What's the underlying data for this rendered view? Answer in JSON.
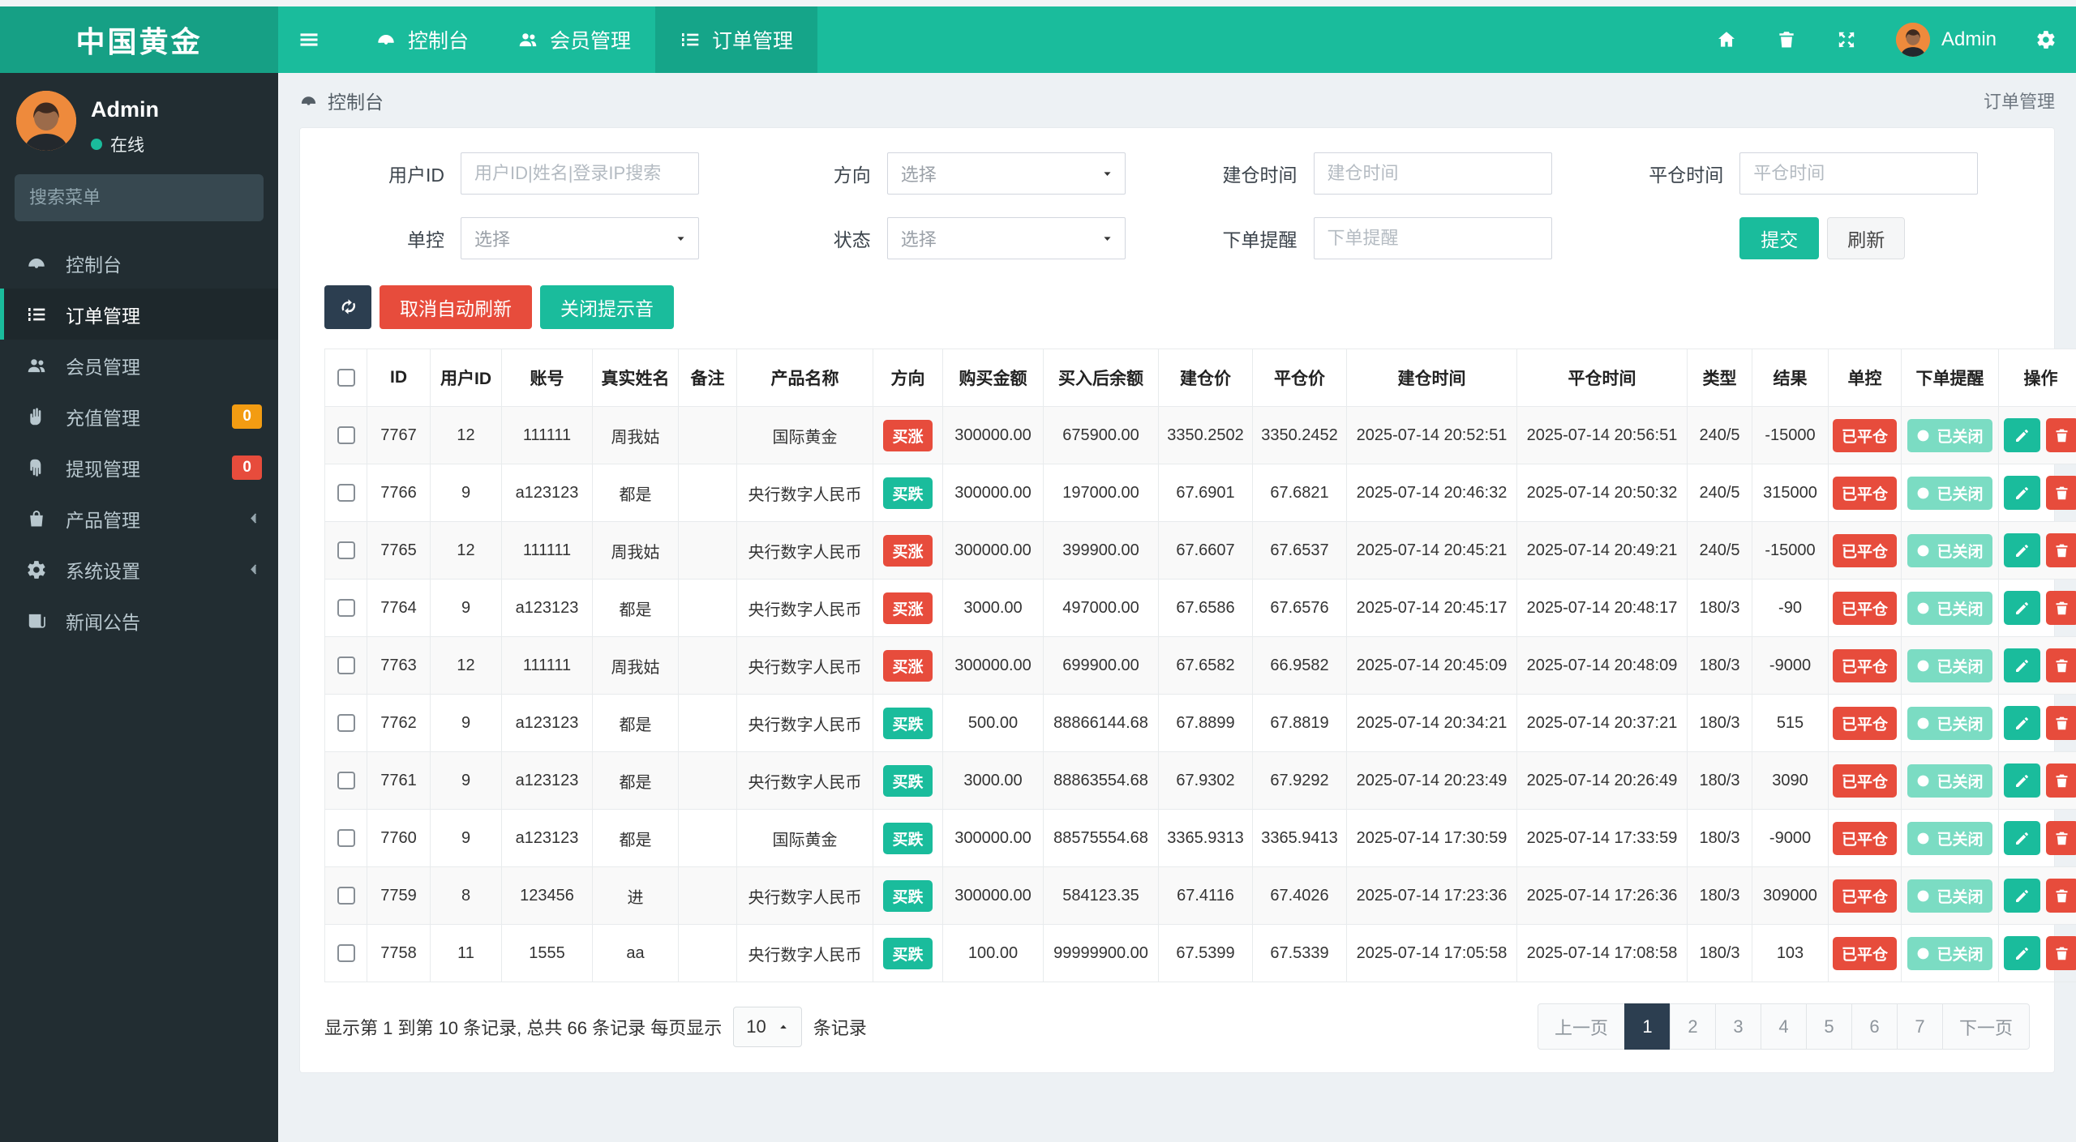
{
  "brand": {
    "title": "中国黄金"
  },
  "topnav": {
    "tabs": [
      {
        "name": "console",
        "label": "控制台",
        "icon": "gauge",
        "active": false
      },
      {
        "name": "members",
        "label": "会员管理",
        "icon": "users",
        "active": false
      },
      {
        "name": "orders",
        "label": "订单管理",
        "icon": "list",
        "active": true
      }
    ],
    "user_name": "Admin"
  },
  "sidebar": {
    "user": {
      "name": "Admin",
      "status": "在线"
    },
    "search_placeholder": "搜索菜单",
    "items": [
      {
        "name": "console",
        "label": "控制台",
        "icon": "gauge"
      },
      {
        "name": "orders",
        "label": "订单管理",
        "icon": "list",
        "active": true
      },
      {
        "name": "members",
        "label": "会员管理",
        "icon": "users"
      },
      {
        "name": "recharge",
        "label": "充值管理",
        "icon": "hand-up",
        "badge": "0",
        "badge_color": "#F39C12"
      },
      {
        "name": "withdraw",
        "label": "提现管理",
        "icon": "hand-down",
        "badge": "0",
        "badge_color": "#E74C3C"
      },
      {
        "name": "products",
        "label": "产品管理",
        "icon": "bag",
        "chevron": true
      },
      {
        "name": "settings",
        "label": "系统设置",
        "icon": "gear",
        "chevron": true
      },
      {
        "name": "news",
        "label": "新闻公告",
        "icon": "news"
      }
    ]
  },
  "breadcrumb": {
    "left": "控制台",
    "right": "订单管理"
  },
  "filters": {
    "fields": {
      "user_id": {
        "label": "用户ID",
        "placeholder": "用户ID|姓名|登录IP搜索"
      },
      "direction": {
        "label": "方向",
        "value": "选择"
      },
      "open_time": {
        "label": "建仓时间",
        "placeholder": "建仓时间"
      },
      "close_time": {
        "label": "平仓时间",
        "placeholder": "平仓时间"
      },
      "control": {
        "label": "单控",
        "value": "选择"
      },
      "status": {
        "label": "状态",
        "value": "选择"
      },
      "order_alert": {
        "label": "下单提醒",
        "placeholder": "下单提醒"
      }
    },
    "submit_label": "提交",
    "refresh_label": "刷新"
  },
  "toolbar": {
    "cancel_auto_refresh": "取消自动刷新",
    "mute_sound": "关闭提示音"
  },
  "colors": {
    "up": "#E74C3C",
    "down": "#1ABC9C",
    "closed_badge": "#7BDCC3",
    "control_badge": "#E74C3C"
  },
  "table": {
    "columns": [
      "ID",
      "用户ID",
      "账号",
      "真实姓名",
      "备注",
      "产品名称",
      "方向",
      "购买金额",
      "买入后余额",
      "建仓价",
      "平仓价",
      "建仓时间",
      "平仓时间",
      "类型",
      "结果",
      "单控",
      "下单提醒",
      "操作"
    ],
    "rows": [
      {
        "id": "7767",
        "user_id": "12",
        "account": "111111",
        "real_name": "周我姑",
        "note": "",
        "product": "国际黄金",
        "direction": {
          "label": "买涨",
          "kind": "up"
        },
        "amount": "300000.00",
        "balance_after": "675900.00",
        "open_price": "3350.2502",
        "close_price": "3350.2452",
        "open_time": "2025-07-14 20:52:51",
        "close_time": "2025-07-14 20:56:51",
        "type": "240/5",
        "result": "-15000",
        "control": "已平仓",
        "notify": "已关闭"
      },
      {
        "id": "7766",
        "user_id": "9",
        "account": "a123123",
        "real_name": "都是",
        "note": "",
        "product": "央行数字人民币",
        "direction": {
          "label": "买跌",
          "kind": "down"
        },
        "amount": "300000.00",
        "balance_after": "197000.00",
        "open_price": "67.6901",
        "close_price": "67.6821",
        "open_time": "2025-07-14 20:46:32",
        "close_time": "2025-07-14 20:50:32",
        "type": "240/5",
        "result": "315000",
        "control": "已平仓",
        "notify": "已关闭"
      },
      {
        "id": "7765",
        "user_id": "12",
        "account": "111111",
        "real_name": "周我姑",
        "note": "",
        "product": "央行数字人民币",
        "direction": {
          "label": "买涨",
          "kind": "up"
        },
        "amount": "300000.00",
        "balance_after": "399900.00",
        "open_price": "67.6607",
        "close_price": "67.6537",
        "open_time": "2025-07-14 20:45:21",
        "close_time": "2025-07-14 20:49:21",
        "type": "240/5",
        "result": "-15000",
        "control": "已平仓",
        "notify": "已关闭"
      },
      {
        "id": "7764",
        "user_id": "9",
        "account": "a123123",
        "real_name": "都是",
        "note": "",
        "product": "央行数字人民币",
        "direction": {
          "label": "买涨",
          "kind": "up"
        },
        "amount": "3000.00",
        "balance_after": "497000.00",
        "open_price": "67.6586",
        "close_price": "67.6576",
        "open_time": "2025-07-14 20:45:17",
        "close_time": "2025-07-14 20:48:17",
        "type": "180/3",
        "result": "-90",
        "control": "已平仓",
        "notify": "已关闭"
      },
      {
        "id": "7763",
        "user_id": "12",
        "account": "111111",
        "real_name": "周我姑",
        "note": "",
        "product": "央行数字人民币",
        "direction": {
          "label": "买涨",
          "kind": "up"
        },
        "amount": "300000.00",
        "balance_after": "699900.00",
        "open_price": "67.6582",
        "close_price": "66.9582",
        "open_time": "2025-07-14 20:45:09",
        "close_time": "2025-07-14 20:48:09",
        "type": "180/3",
        "result": "-9000",
        "control": "已平仓",
        "notify": "已关闭"
      },
      {
        "id": "7762",
        "user_id": "9",
        "account": "a123123",
        "real_name": "都是",
        "note": "",
        "product": "央行数字人民币",
        "direction": {
          "label": "买跌",
          "kind": "down"
        },
        "amount": "500.00",
        "balance_after": "88866144.68",
        "open_price": "67.8899",
        "close_price": "67.8819",
        "open_time": "2025-07-14 20:34:21",
        "close_time": "2025-07-14 20:37:21",
        "type": "180/3",
        "result": "515",
        "control": "已平仓",
        "notify": "已关闭"
      },
      {
        "id": "7761",
        "user_id": "9",
        "account": "a123123",
        "real_name": "都是",
        "note": "",
        "product": "央行数字人民币",
        "direction": {
          "label": "买跌",
          "kind": "down"
        },
        "amount": "3000.00",
        "balance_after": "88863554.68",
        "open_price": "67.9302",
        "close_price": "67.9292",
        "open_time": "2025-07-14 20:23:49",
        "close_time": "2025-07-14 20:26:49",
        "type": "180/3",
        "result": "3090",
        "control": "已平仓",
        "notify": "已关闭"
      },
      {
        "id": "7760",
        "user_id": "9",
        "account": "a123123",
        "real_name": "都是",
        "note": "",
        "product": "国际黄金",
        "direction": {
          "label": "买跌",
          "kind": "down"
        },
        "amount": "300000.00",
        "balance_after": "88575554.68",
        "open_price": "3365.9313",
        "close_price": "3365.9413",
        "open_time": "2025-07-14 17:30:59",
        "close_time": "2025-07-14 17:33:59",
        "type": "180/3",
        "result": "-9000",
        "control": "已平仓",
        "notify": "已关闭"
      },
      {
        "id": "7759",
        "user_id": "8",
        "account": "123456",
        "real_name": "进",
        "note": "",
        "product": "央行数字人民币",
        "direction": {
          "label": "买跌",
          "kind": "down"
        },
        "amount": "300000.00",
        "balance_after": "584123.35",
        "open_price": "67.4116",
        "close_price": "67.4026",
        "open_time": "2025-07-14 17:23:36",
        "close_time": "2025-07-14 17:26:36",
        "type": "180/3",
        "result": "309000",
        "control": "已平仓",
        "notify": "已关闭"
      },
      {
        "id": "7758",
        "user_id": "11",
        "account": "1555",
        "real_name": "aa",
        "note": "",
        "product": "央行数字人民币",
        "direction": {
          "label": "买跌",
          "kind": "down"
        },
        "amount": "100.00",
        "balance_after": "99999900.00",
        "open_price": "67.5399",
        "close_price": "67.5339",
        "open_time": "2025-07-14 17:05:58",
        "close_time": "2025-07-14 17:08:58",
        "type": "180/3",
        "result": "103",
        "control": "已平仓",
        "notify": "已关闭"
      }
    ]
  },
  "footer": {
    "summary_prefix": "显示第 1 到第 10 条记录, 总共 66 条记录 每页显示",
    "page_size": "10",
    "summary_suffix": "条记录",
    "pagination": {
      "prev_label": "上一页",
      "pages": [
        "1",
        "2",
        "3",
        "4",
        "5",
        "6",
        "7"
      ],
      "active_page": "1",
      "next_label": "下一页"
    }
  }
}
